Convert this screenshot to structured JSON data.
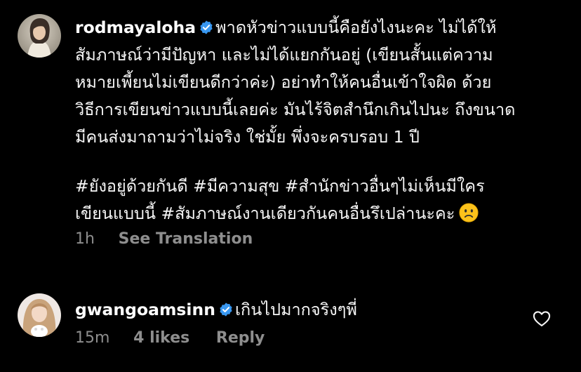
{
  "post": {
    "username": "rodmayaloha",
    "verified": true,
    "lines": [
      "พาดหัวข่าวแบบนี้คือยังไงนะคะ ไม่ได้ให้",
      "สัมภาษณ์ว่ามีปัญหา และไม่ได้แยกกันอยู่ (เขียนสั้นแต่ความ",
      "หมายเพี้ยนไม่เขียนดีกว่าค่ะ) อย่าทำให้คนอื่นเข้าใจผิด ด้วย",
      "วิธีการเขียนข่าวแบบนี้เลยค่ะ มันไร้จิตสำนึกเกินไปนะ ถึงขนาด",
      "มีคนส่งมาถามว่าไม่จริง ใช่มั้ย พึ่งจะครบรอบ 1 ปี"
    ],
    "hashtag_lines": [
      "#ยังอยู่ด้วยกันดี #มีความสุข #สำนักข่าวอื่นๆไม่เห็นมีใคร",
      "เขียนแบบนี้ #สัมภาษณ์งานเดียวกันคนอื่นรึเปล่านะคะ"
    ],
    "emoji": "slightly-frowning-face",
    "time": "1h",
    "see_translation": "See Translation"
  },
  "reply": {
    "username": "gwangoamsinn",
    "verified": true,
    "text": "เกินไปมากจริงๆพี่",
    "time": "15m",
    "likes": "4 likes",
    "reply_label": "Reply"
  },
  "colors": {
    "background": "#000000",
    "text": "#f5f5f5",
    "secondary": "#8e8e8e",
    "verified_blue": "#3897f0",
    "divider": "#262626"
  }
}
